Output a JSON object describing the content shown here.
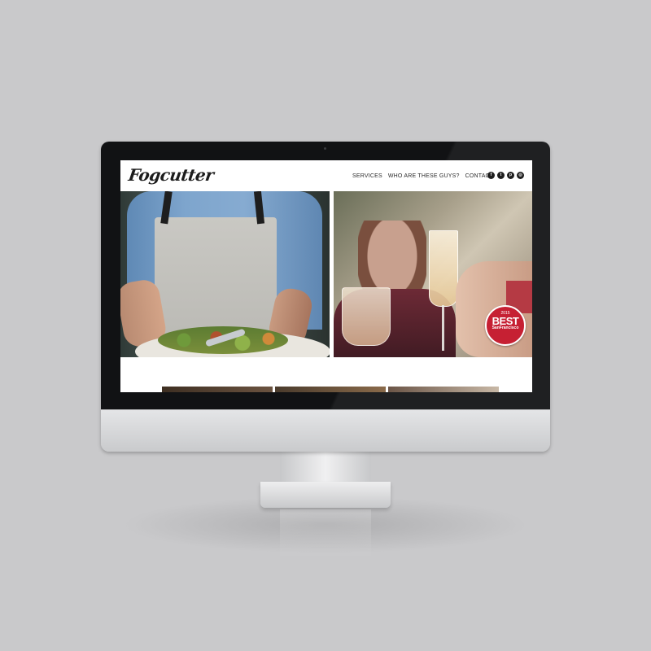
{
  "site": {
    "logo_text": "Fogcutter",
    "nav": [
      {
        "label": "SERVICES"
      },
      {
        "label": "WHO ARE THESE GUYS?"
      },
      {
        "label": "CONTACT"
      }
    ],
    "social_icons": [
      {
        "icon": "facebook-icon",
        "glyph": "f"
      },
      {
        "icon": "twitter-icon",
        "glyph": "t"
      },
      {
        "icon": "pinterest-icon",
        "glyph": "p"
      },
      {
        "icon": "instagram-icon",
        "glyph": "◎"
      }
    ]
  },
  "hero": {
    "left_photo": "chef-in-apron-holding-salad-platter",
    "right_photo": "champagne-toast"
  },
  "badge": {
    "year": "2015",
    "title": "BEST",
    "subtitle": "SanFrancisco"
  },
  "colors": {
    "background": "#c9c9cb",
    "bezel": "#111214",
    "badge_red": "#c62033",
    "text_dark": "#2a2a2a"
  }
}
